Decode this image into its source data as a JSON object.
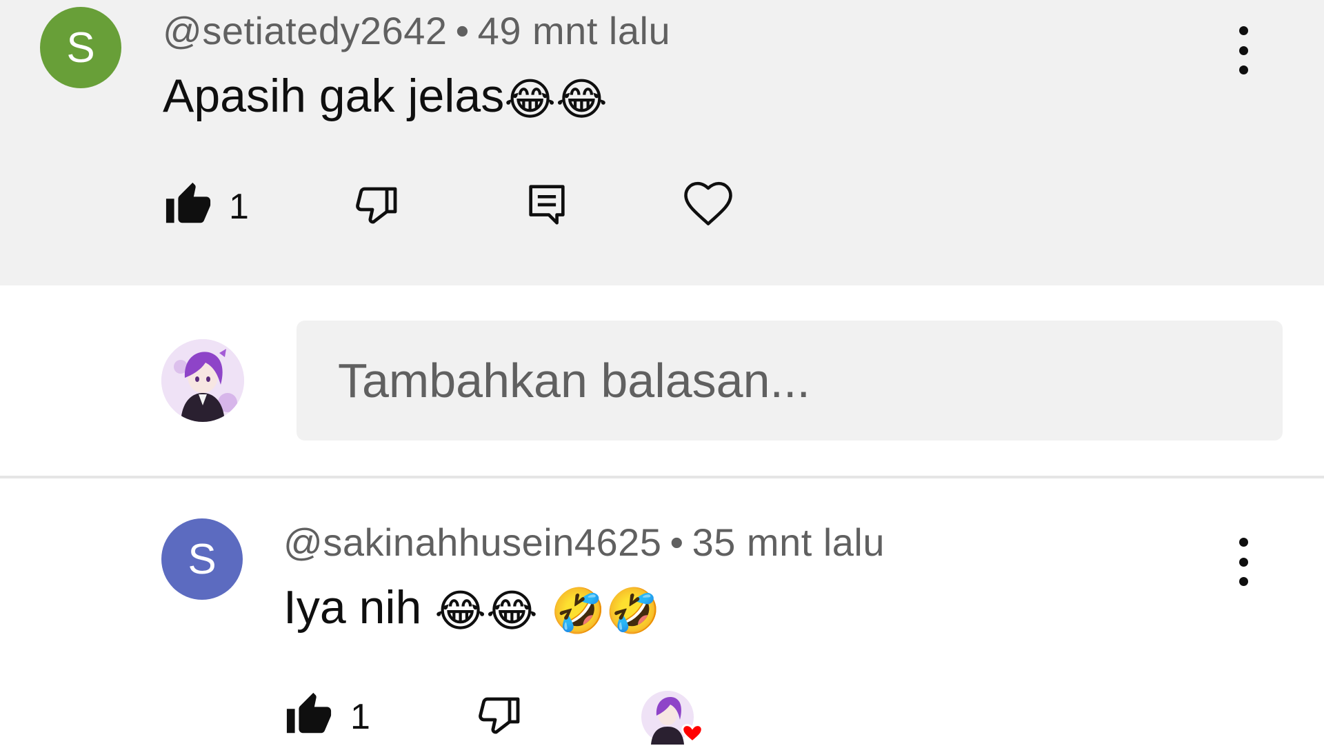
{
  "comment1": {
    "avatar_letter": "S",
    "author": "@setiatedy2642",
    "separator": "•",
    "time": "49 mnt lalu",
    "text": "Apasih gak jelas",
    "text_emojis": [
      "😂",
      "😂"
    ],
    "like_count": "1",
    "colors": {
      "avatar_bg": "#689f38",
      "background": "#f1f1f1"
    },
    "icons": [
      "like-filled-icon",
      "dislike-icon",
      "reply-icon",
      "heart-icon",
      "more-vert-icon"
    ]
  },
  "reply_box": {
    "placeholder": "Tambahkan balasan..."
  },
  "comment2": {
    "avatar_letter": "S",
    "author": "@sakinahhusein4625",
    "separator": "•",
    "time": "35 mnt lalu",
    "text": "Iya nih",
    "text_emojis": [
      "😂",
      "😂",
      "🤣",
      "🤣"
    ],
    "like_count": "1",
    "colors": {
      "avatar_bg": "#5c6bc0"
    },
    "icons": [
      "like-filled-icon",
      "dislike-icon",
      "creator-heart-icon",
      "more-vert-icon"
    ]
  }
}
